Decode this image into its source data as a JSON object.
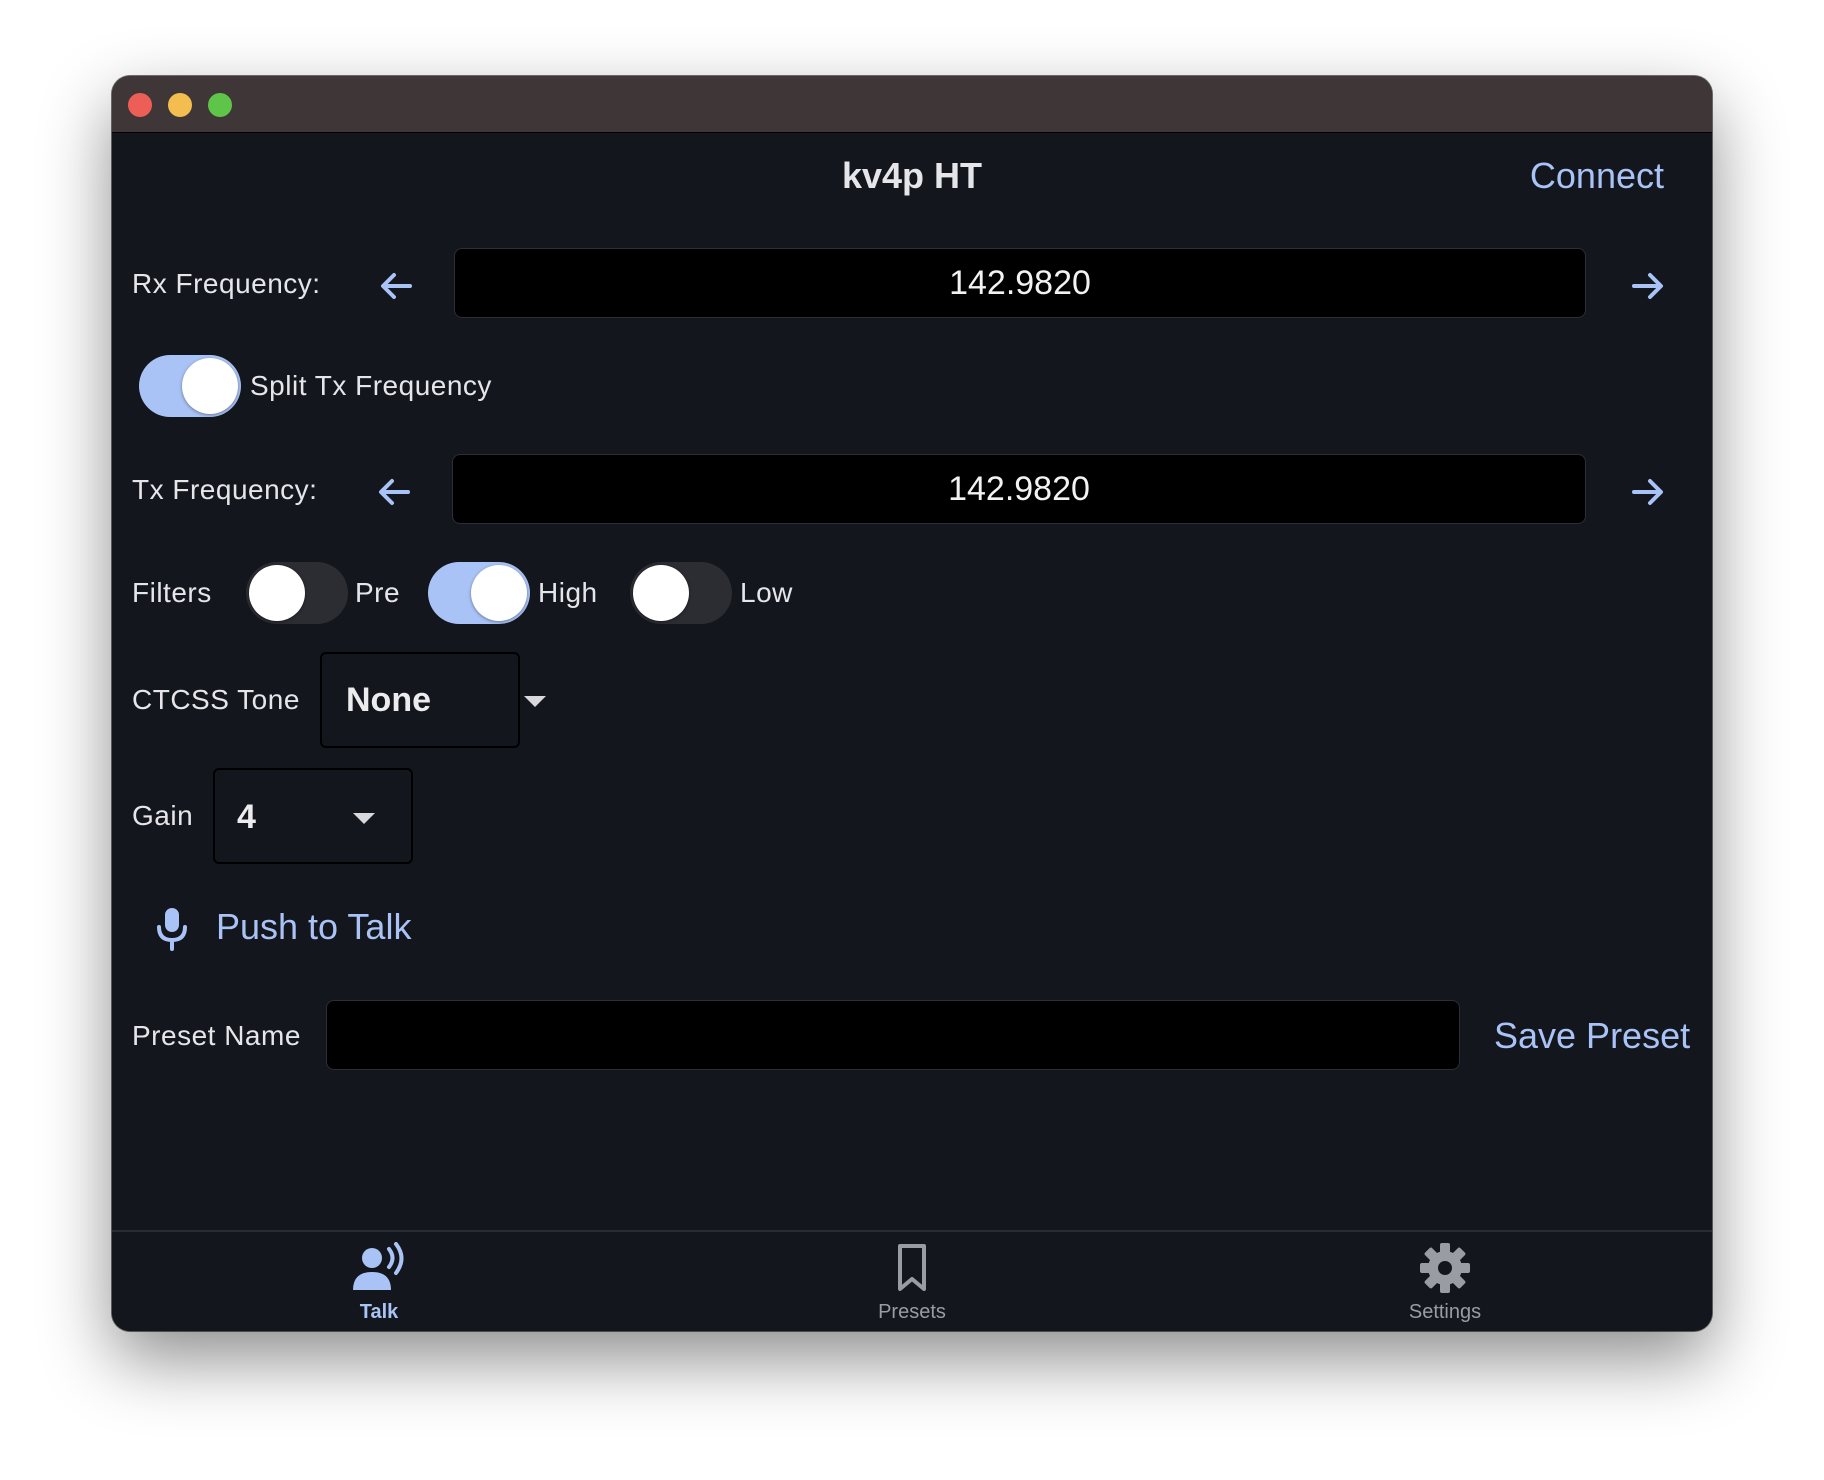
{
  "window": {
    "title": ""
  },
  "header": {
    "title": "kv4p HT",
    "connect_label": "Connect"
  },
  "rx": {
    "label": "Rx Frequency:",
    "value": "142.9820"
  },
  "split": {
    "label": "Split Tx Frequency",
    "on": true
  },
  "tx": {
    "label": "Tx Frequency:",
    "value": "142.9820"
  },
  "filters": {
    "label": "Filters",
    "items": [
      {
        "label": "Pre",
        "on": false
      },
      {
        "label": "High",
        "on": true
      },
      {
        "label": "Low",
        "on": false
      }
    ]
  },
  "ctcss": {
    "label": "CTCSS Tone",
    "value": "None"
  },
  "gain": {
    "label": "Gain",
    "value": "4"
  },
  "ptt": {
    "label": "Push to Talk",
    "icon": "microphone-icon"
  },
  "preset": {
    "label": "Preset Name",
    "value": "",
    "save_label": "Save Preset"
  },
  "nav": {
    "items": [
      {
        "label": "Talk",
        "icon": "talk-icon",
        "active": true
      },
      {
        "label": "Presets",
        "icon": "bookmark-icon",
        "active": false
      },
      {
        "label": "Settings",
        "icon": "gear-icon",
        "active": false
      }
    ]
  },
  "colors": {
    "accent": "#a9c3f6",
    "background": "#13161c",
    "titlebar": "#3f3737",
    "field": "#000000",
    "text": "#e6e6ea"
  }
}
